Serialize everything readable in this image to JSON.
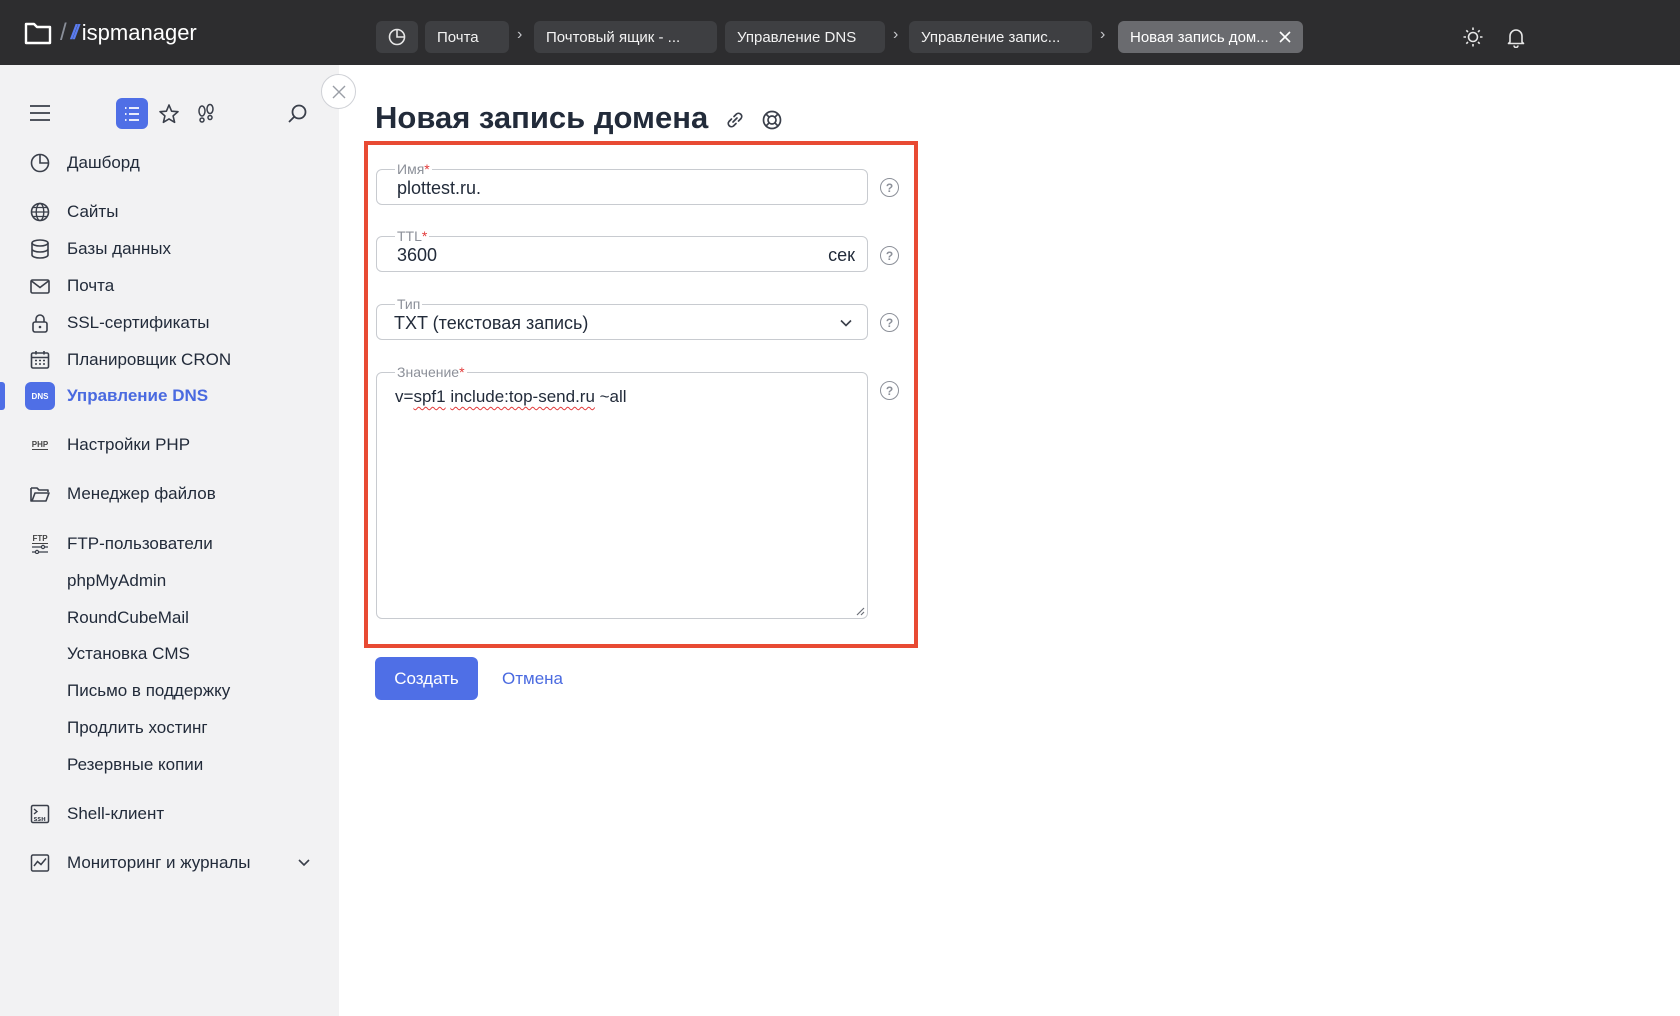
{
  "app": {
    "logo_text": "ispmanager"
  },
  "breadcrumbs": [
    {
      "label": "Почта"
    },
    {
      "label": "Почтовый ящик - ..."
    },
    {
      "label": "Управление DNS"
    },
    {
      "label": "Управление запис..."
    },
    {
      "label": "Новая запись дом..."
    }
  ],
  "sidebar": {
    "items": [
      {
        "label": "Дашборд",
        "icon": "dashboard-icon"
      },
      {
        "label": "Сайты",
        "icon": "globe-icon"
      },
      {
        "label": "Базы данных",
        "icon": "database-icon"
      },
      {
        "label": "Почта",
        "icon": "mail-icon"
      },
      {
        "label": "SSL-сертификаты",
        "icon": "lock-icon"
      },
      {
        "label": "Планировщик CRON",
        "icon": "calendar-icon"
      },
      {
        "label": "Управление DNS",
        "icon": "dns-icon",
        "badge": "DNS",
        "active": true
      },
      {
        "label": "Настройки PHP",
        "icon": "php-icon",
        "badge": "PHP"
      },
      {
        "label": "Менеджер файлов",
        "icon": "folder-icon"
      },
      {
        "label": "FTP-пользователи",
        "icon": "ftp-icon",
        "badge": "FTP"
      },
      {
        "label": "phpMyAdmin"
      },
      {
        "label": "RoundCubeMail"
      },
      {
        "label": "Установка CMS"
      },
      {
        "label": "Письмо в поддержку"
      },
      {
        "label": "Продлить хостинг"
      },
      {
        "label": "Резервные копии"
      },
      {
        "label": "Shell-клиент",
        "icon": "terminal-icon",
        "badge": "SSH"
      },
      {
        "label": "Мониторинг и журналы",
        "icon": "chart-icon"
      }
    ]
  },
  "form": {
    "title": "Новая запись домена",
    "name": {
      "label": "Имя",
      "required_mark": "*",
      "value": "plottest.ru."
    },
    "ttl": {
      "label": "TTL",
      "required_mark": "*",
      "value": "3600",
      "unit": "сек"
    },
    "type": {
      "label": "Тип",
      "value": "TXT (текстовая запись)"
    },
    "value": {
      "label": "Значение",
      "required_mark": "*",
      "text_prefix": "v=",
      "text_spf": "spf1",
      "text_space": " ",
      "text_include": "include:top-send.ru",
      "text_suffix": " ~all"
    },
    "help_mark": "?",
    "submit_label": "Создать",
    "cancel_label": "Отмена"
  },
  "colors": {
    "accent": "#4f6fe6",
    "highlight": "#e84a33",
    "topbar": "#2d2d2f",
    "sidebar": "#f2f2f3"
  }
}
